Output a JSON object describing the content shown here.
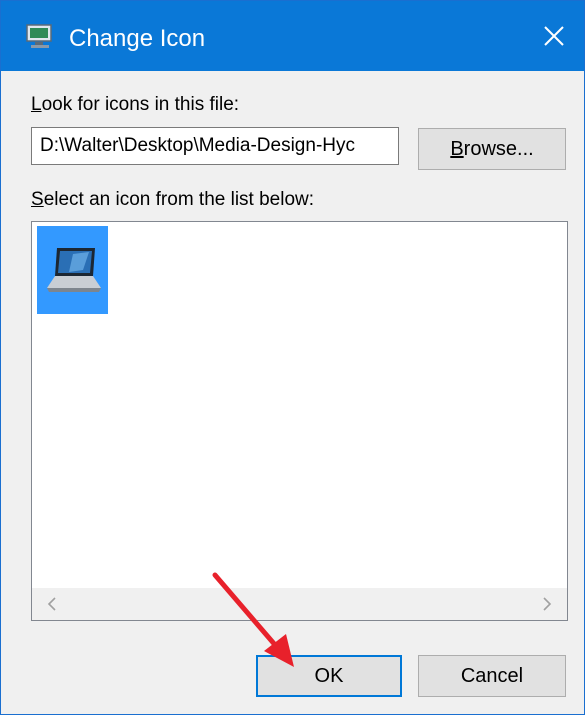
{
  "window": {
    "title": "Change Icon",
    "title_icon": "monitor-icon",
    "close_icon": "close-icon"
  },
  "file_section": {
    "label_underlined": "L",
    "label_rest": "ook for icons in this file:",
    "path_value": "D:\\Walter\\Desktop\\Media-Design-Hyc",
    "browse_underlined": "B",
    "browse_rest": "rowse..."
  },
  "list_section": {
    "label_underlined": "S",
    "label_rest": "elect an icon from the list below:",
    "items": [
      {
        "icon": "laptop-icon",
        "selected": true
      }
    ],
    "scroll_left_icon": "chevron-left-icon",
    "scroll_right_icon": "chevron-right-icon"
  },
  "buttons": {
    "ok_label": "OK",
    "cancel_label": "Cancel"
  },
  "annotation": {
    "arrow_color": "#e8212b"
  },
  "colors": {
    "titlebar": "#0a78d7",
    "selection": "#3399ff",
    "focus_border": "#0078d7"
  }
}
